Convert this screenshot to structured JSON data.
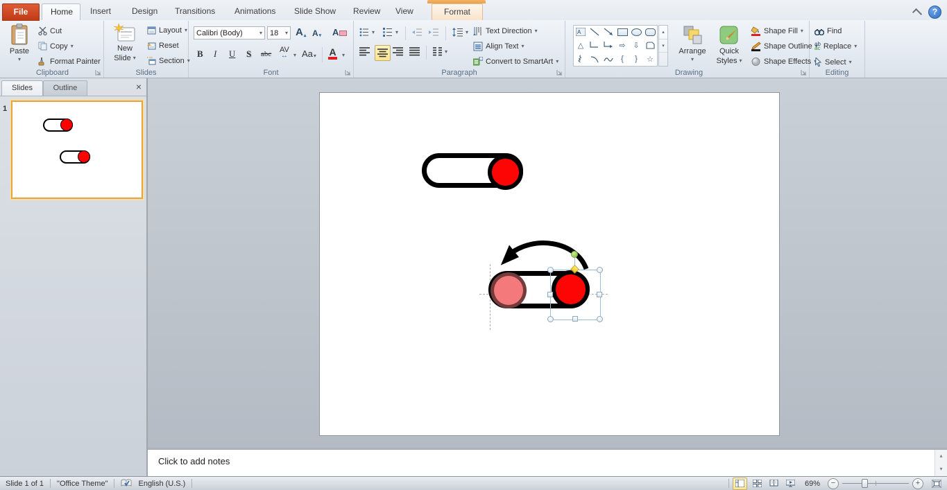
{
  "icons": {
    "dropdown": "▾",
    "scroll_up": "▴",
    "scroll_down": "▾",
    "star": "☆",
    "triangle": "△",
    "arrow_right": "⇨",
    "arrow_down": "⇩",
    "brace_open": "{",
    "brace_close": "}",
    "close": "×",
    "help": "?",
    "check": "✓",
    "zoom_out": "−",
    "zoom_in": "+",
    "arrow_lr": "↔",
    "replace_ab": "ab",
    "replace_ac": "ac"
  },
  "ribbon": {
    "tabs": {
      "file": "File",
      "home": "Home",
      "insert": "Insert",
      "design": "Design",
      "transitions": "Transitions",
      "animations": "Animations",
      "slide_show": "Slide Show",
      "review": "Review",
      "view": "View",
      "format": "Format"
    },
    "clipboard": {
      "label": "Clipboard",
      "paste": "Paste",
      "cut": "Cut",
      "copy": "Copy",
      "format_painter": "Format Painter"
    },
    "slides": {
      "label": "Slides",
      "new_slide_1": "New",
      "new_slide_2": "Slide",
      "layout": "Layout",
      "reset": "Reset",
      "section": "Section"
    },
    "font": {
      "label": "Font",
      "name": "Calibri (Body)",
      "size": "18",
      "grow": "A",
      "shrink": "A",
      "clear": "A",
      "bold": "B",
      "italic": "I",
      "underline": "U",
      "shadow": "S",
      "strike": "abc",
      "spacing": "AV",
      "case": "Aa",
      "color": "A"
    },
    "paragraph": {
      "label": "Paragraph",
      "text_direction": "Text Direction",
      "align_text": "Align Text",
      "smartart": "Convert to SmartArt"
    },
    "drawing": {
      "label": "Drawing",
      "arrange": "Arrange",
      "quick_styles_1": "Quick",
      "quick_styles_2": "Styles",
      "shape_fill": "Shape Fill",
      "shape_outline": "Shape Outline",
      "shape_effects": "Shape Effects"
    },
    "editing": {
      "label": "Editing",
      "find": "Find",
      "replace": "Replace",
      "select": "Select"
    }
  },
  "slides_panel": {
    "slides_tab": "Slides",
    "outline_tab": "Outline",
    "slide_number": "1"
  },
  "notes": {
    "placeholder": "Click to add notes"
  },
  "status": {
    "slide_info": "Slide 1 of 1",
    "theme": "\"Office Theme\"",
    "language": "English (U.S.)",
    "zoom_level": "69%"
  },
  "slide_content": {
    "knob_color": "#FE0505",
    "knob_color_faded": "#F4797B",
    "outline_color": "#000000"
  }
}
